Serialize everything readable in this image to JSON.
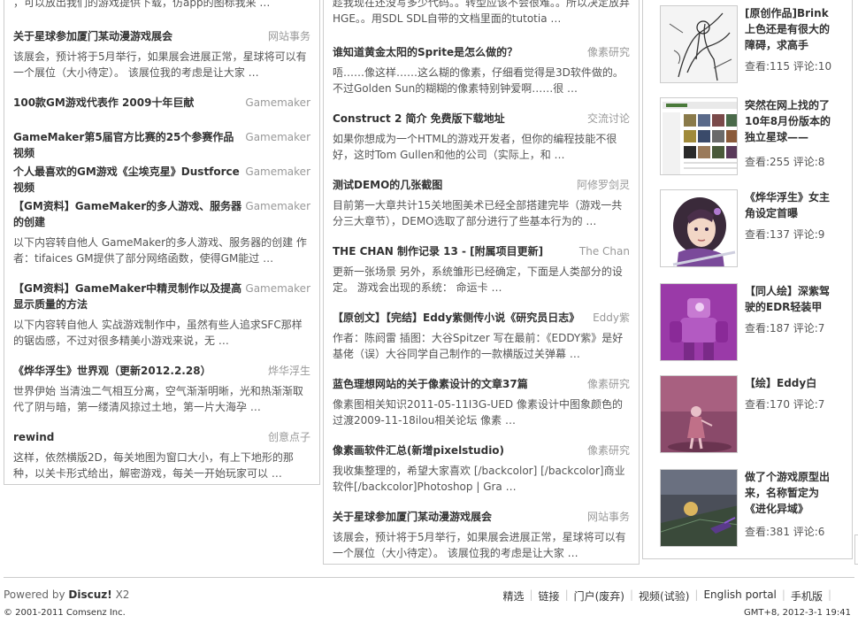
{
  "col1": {
    "snippet": "，可以放出我们的游戏提供下载，仿app的图标我来 …",
    "articles": [
      {
        "title": "关于星球参加厦门某动漫游戏展会",
        "cat": "网站事务",
        "summary": "该展会，预计将于5月举行，如果展会进展正常，星球将可以有一个展位（大小待定）。 该展位我的考虑是让大家 …"
      },
      {
        "title": "100款GM游戏代表作 2009十年巨献",
        "cat": "Gamemaker",
        "summary": ""
      },
      {
        "title": "GameMaker第5届官方比赛的25个参赛作品视频",
        "cat": "Gamemaker",
        "summary": ""
      },
      {
        "title": "个人最喜欢的GM游戏《尘埃克星》Dustforce视频",
        "cat": "Gamemaker",
        "summary": ""
      },
      {
        "title": "【GM资料】GameMaker的多人游戏、服务器的创建",
        "cat": "Gamemaker",
        "summary": "以下内容转自他人 GameMaker的多人游戏、服务器的创建 作者：tifaices GM提供了部分网络函数，使得GM能过 …"
      },
      {
        "title": "【GM资料】GameMaker中精灵制作以及提高显示质量的方法",
        "cat": "Gamemaker",
        "summary": "以下内容转自他人 实战游戏制作中，虽然有些人追求SFC那样的锯齿感，不过对很多精美小游戏来说，无 …"
      },
      {
        "title": "《烨华浮生》世界观（更新2012.2.28）",
        "cat": "烨华浮生",
        "summary": "世界伊始 当清浊二气相互分离，空气渐渐明晰，光和热渐渐取代了阴与暗，第一缕清风掠过土地，第一片大海孕 …"
      },
      {
        "title": "rewind",
        "cat": "创意点子",
        "summary": "这样，依然横版2D，每关地图为窗口大小，有上下地形的那种，以关卡形式给出，解密游戏，每关一开始玩家可以 …"
      }
    ]
  },
  "col2": {
    "snippet": "趁我现在还没写多少代码。。转型应该不会很难。。所以决定放弃HGE。。用SDL SDL自带的文档里面的tutotia …",
    "articles": [
      {
        "title": "谁知道黄金太阳的Sprite是怎么做的？",
        "cat": "像素研究",
        "summary": "唔……像这样……这么糊的像素，仔细看觉得是3D软件做的。 不过Golden Sun的糊糊的像素特别钟爱啊……很 …"
      },
      {
        "title": "Construct 2 简介 免费版下载地址",
        "cat": "交流讨论",
        "summary": "如果你想成为一个HTML的游戏开发者，但你的编程技能不很好，这时Tom Gullen和他的公司（实际上，和 …"
      },
      {
        "title": "测试DEMO的几张截图",
        "cat": "阿修罗剑灵",
        "summary": "目前第一大章共计15关地图美术已经全部搭建完毕（游戏一共分三大章节），DEMO选取了部分进行了些基本行为的 …"
      },
      {
        "title": "THE CHAN 制作记录 13 - [附属项目更新]",
        "cat": "The Chan",
        "summary": "更新一张场景 另外，系统雏形已经确定，下面是人类部分的设定。 游戏会出现的系统： 命运卡 …"
      },
      {
        "title": "【原创文】【完结】Eddy紫侧传小说《研究员日志》",
        "cat": "Eddy紫",
        "summary": "作者：陈阏雷 插图：大谷Spitzer 写在最前：《EDDY紫》是好基佬（误）大谷同学自己制作的一款横版过关弹幕 …"
      },
      {
        "title": "蓝色理想网站的关于像素设计的文章37篇",
        "cat": "像素研究",
        "summary": " 像素图相关知识2011-05-11Ⅰ3G-UED 像素设计中图象颜色的过渡2009-11-18ilou相关论坛 像素 …"
      },
      {
        "title": "像素画软件汇总(新增pixelstudio)",
        "cat": "像素研究",
        "summary": "我收集整理的，希望大家喜欢 [/backcolor] [/backcolor]商业软件[/backcolor]Photoshop | Gra …"
      },
      {
        "title": "关于星球参加厦门某动漫游戏展会",
        "cat": "网站事务",
        "summary": "该展会，预计将于5月举行，如果展会进展正常，星球将可以有一个展位（大小待定）。 该展位我的考虑是让大家 …"
      }
    ]
  },
  "col3": {
    "items": [
      {
        "title": "[原创作品]Brink上色还是有很大的障碍，求高手",
        "stats": "查看:115 评论:10",
        "thumb": "sketch"
      },
      {
        "title": "突然在网上找的了10年8月份版本的独立星球——",
        "stats": "查看:255 评论:8",
        "thumb": "website"
      },
      {
        "title": "《烨华浮生》女主角设定首曝",
        "stats": "查看:137 评论:9",
        "thumb": "girl"
      },
      {
        "title": "【同人绘】深紫驾驶的EDR轻装甲",
        "stats": "查看:187 评论:7",
        "thumb": "mecha"
      },
      {
        "title": "【绘】Eddy白",
        "stats": "查看:170 评论:7",
        "thumb": "eddy"
      },
      {
        "title": "做了个游戏原型出来，名称暂定为《进化异域》",
        "stats": "查看:381 评论:6",
        "thumb": "game3d"
      }
    ]
  },
  "footer": {
    "powered_prefix": "Powered by",
    "powered_brand": "Discuz!",
    "powered_version": "X2",
    "copyright": "© 2001-2011 Comsenz Inc.",
    "nav": [
      "精选",
      "链接",
      "门户(废弃)",
      "视频(试验)",
      "English portal",
      "手机版"
    ],
    "gmt": "GMT+8, 2012-3-1 19:41"
  },
  "colors": {
    "border": "#cccccc",
    "category": "#999999",
    "title": "#333333"
  }
}
